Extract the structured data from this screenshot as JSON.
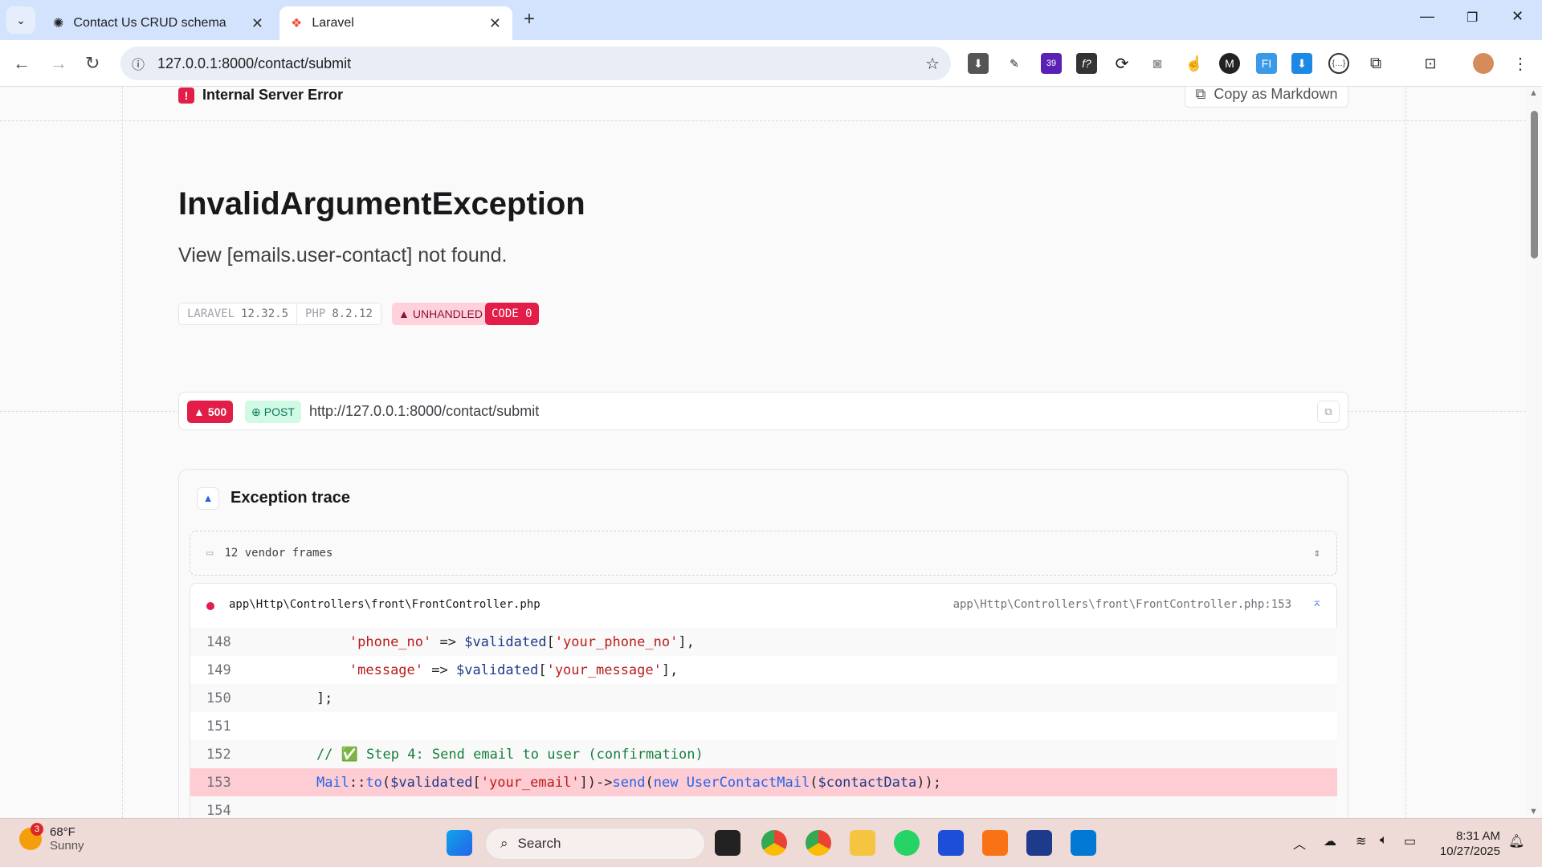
{
  "browser": {
    "tabs": [
      {
        "title": "Contact Us CRUD schema",
        "active": false
      },
      {
        "title": "Laravel",
        "active": true
      }
    ],
    "url": "127.0.0.1:8000/contact/submit",
    "extension_badge": "39"
  },
  "page": {
    "status_label": "Internal Server Error",
    "copy_markdown": "Copy as Markdown",
    "exception_class": "InvalidArgumentException",
    "message": "View [emails.user-contact] not found.",
    "badges": {
      "laravel_label": "LARAVEL",
      "laravel_version": "12.32.5",
      "php_label": "PHP",
      "php_version": "8.2.12",
      "unhandled": "UNHANDLED",
      "code": "CODE 0"
    },
    "request": {
      "status": "500",
      "method": "POST",
      "url": "http://127.0.0.1:8000/contact/submit"
    },
    "trace": {
      "title": "Exception trace",
      "vendor_frames": "12 vendor frames",
      "frame_file": "app\\Http\\Controllers\\front\\FrontController.php",
      "frame_location": "app\\Http\\Controllers\\front\\FrontController.php:153",
      "lines": [
        {
          "n": "148",
          "code": "        'phone_no' => $validated['your_phone_no'],"
        },
        {
          "n": "149",
          "code": "        'message' => $validated['your_message'],"
        },
        {
          "n": "150",
          "code": "    ];"
        },
        {
          "n": "151",
          "code": ""
        },
        {
          "n": "152",
          "code": "    // ✅ Step 4: Send email to user (confirmation)"
        },
        {
          "n": "153",
          "code": "    Mail::to($validated['your_email'])->send(new UserContactMail($contactData));",
          "highlight": true
        },
        {
          "n": "154",
          "code": ""
        }
      ]
    }
  },
  "taskbar": {
    "weather_temp": "68°F",
    "weather_desc": "Sunny",
    "weather_badge": "3",
    "search_placeholder": "Search",
    "time": "8:31 AM",
    "date": "10/27/2025"
  },
  "colors": {
    "accent_red": "#e11d48",
    "highlight": "#fecdd3",
    "tab_bg": "#d3e3fd",
    "taskbar_bg": "#eedad6"
  }
}
